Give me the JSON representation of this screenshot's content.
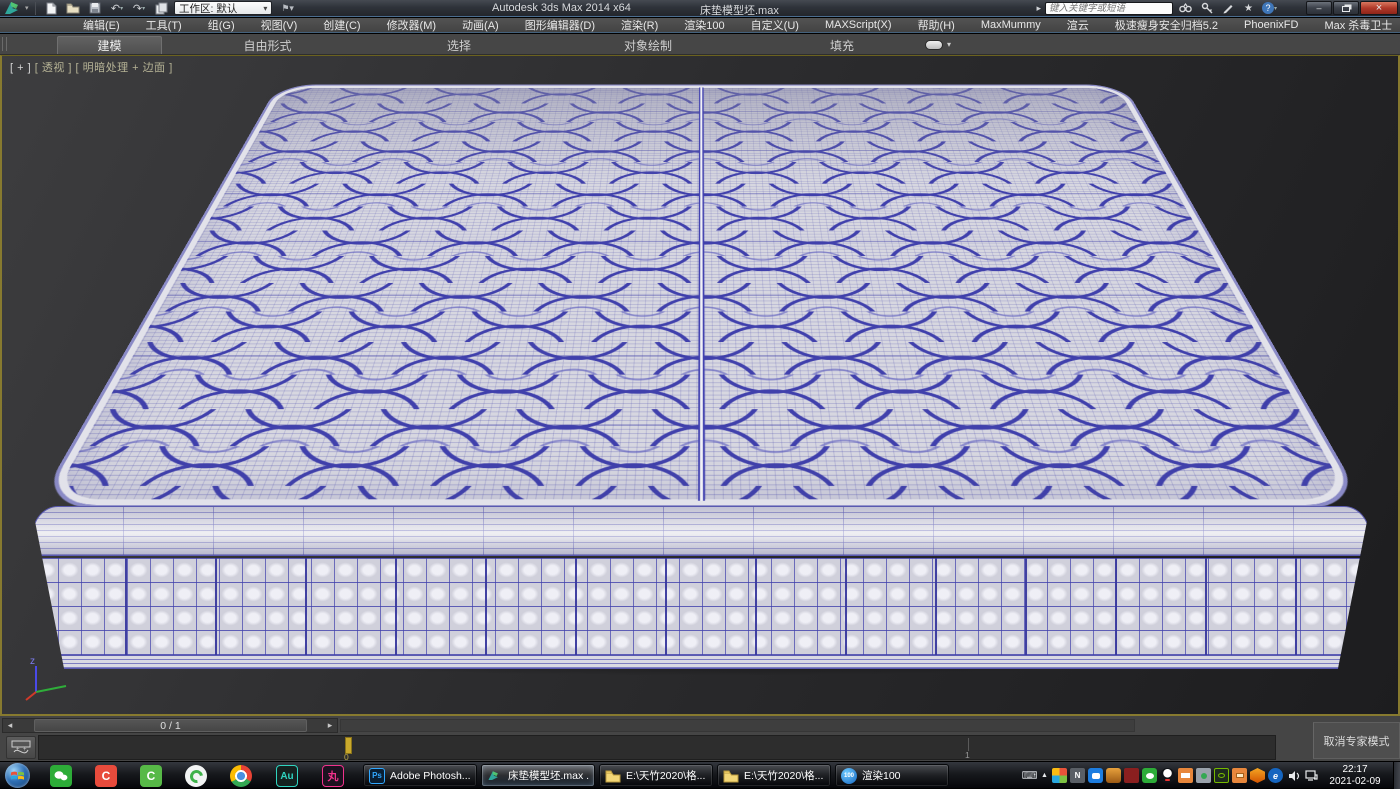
{
  "title_bar": {
    "app_title": "Autodesk 3ds Max  2014 x64",
    "doc_title": "床垫模型坯.max",
    "workspace": "工作区: 默认",
    "search_placeholder": "键入关键字或短语",
    "minimize": "–",
    "close": "×",
    "undo": "↶",
    "redo": "↷",
    "help": "?"
  },
  "menu_bar": {
    "items": [
      "编辑(E)",
      "工具(T)",
      "组(G)",
      "视图(V)",
      "创建(C)",
      "修改器(M)",
      "动画(A)",
      "图形编辑器(D)",
      "渲染(R)",
      "渲染100",
      "自定义(U)",
      "MAXScript(X)",
      "帮助(H)",
      "MaxMummy",
      "渲云",
      "极速瘦身安全归档5.2",
      "PhoenixFD",
      "Max 杀毒卫士"
    ]
  },
  "ribbon": {
    "tabs": [
      "建模",
      "自由形式",
      "选择",
      "对象绘制",
      "填充"
    ],
    "active_tab": "建模"
  },
  "viewport": {
    "label_general": "[ + ]",
    "label_pov": "[ 透视 ]",
    "label_shading": "[ 明暗处理 + 边面 ]",
    "axis_z_label": "z"
  },
  "timeline": {
    "frame_indicator": "0 / 1",
    "tick_labels": [
      "0",
      "1"
    ],
    "expert_mode_button": "取消专家模式"
  },
  "taskbar": {
    "buttons": [
      {
        "label": "Adobe Photosh...",
        "icon": "photoshop"
      },
      {
        "label": "床垫模型坯.max ...",
        "icon": "3dsmax"
      },
      {
        "label": "E:\\天竹2020\\格...",
        "icon": "folder"
      },
      {
        "label": "E:\\天竹2020\\格...",
        "icon": "folder"
      },
      {
        "label": "渲染100",
        "icon": "render100"
      }
    ],
    "ps_icon_text": "Ps",
    "au_icon_text": "Au",
    "wan_icon_text": "丸",
    "render100_icon_text": "100",
    "tray_icons": [
      "ime-keyboard",
      "hidden-icons-arrow",
      "translator-icon",
      "ime-tool-icon",
      "tim-icon",
      "jar-icon",
      "reader-icon",
      "wechat-icon",
      "qq-icon",
      "window-tool-icon",
      "usb-eject-icon",
      "nvidia-icon",
      "screenshot-icon",
      "security-icon",
      "internet-icon",
      "volume-icon",
      "network-icon"
    ],
    "clock": {
      "time": "22:17",
      "date": "2021-02-09"
    }
  },
  "colors": {
    "viewport_border": "#877a2f",
    "wireframe_blue": "#4040ac",
    "mattress_base": "#d7d7e0",
    "time_marker_yellow": "#c9a92c",
    "close_button_red": "#b03a2a"
  }
}
